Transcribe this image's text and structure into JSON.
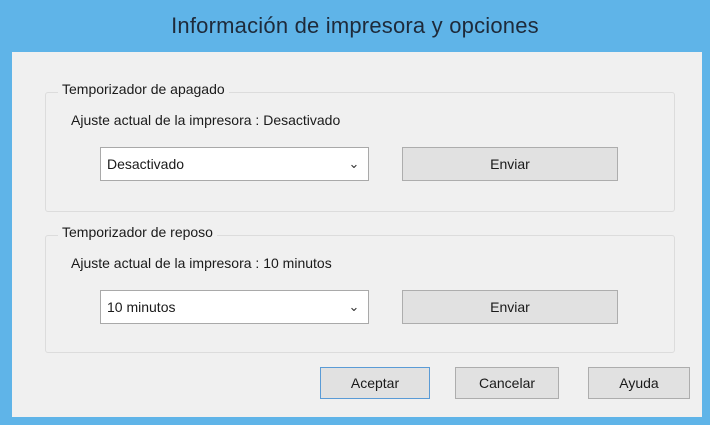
{
  "window": {
    "title": "Información de impresora y opciones"
  },
  "power_off_timer": {
    "legend": "Temporizador de apagado",
    "current_setting": "Ajuste actual de la impresora : Desactivado",
    "selected": "Desactivado",
    "send_label": "Enviar"
  },
  "sleep_timer": {
    "legend": "Temporizador de reposo",
    "current_setting": "Ajuste actual de la impresora : 10 minutos",
    "selected": "10 minutos",
    "send_label": "Enviar"
  },
  "footer": {
    "ok_label": "Aceptar",
    "cancel_label": "Cancelar",
    "help_label": "Ayuda"
  },
  "icons": {
    "dropdown": "chevron-down-icon"
  },
  "colors": {
    "titlebar": "#5fb4e8",
    "client": "#f0f0f0",
    "button": "#e1e1e1",
    "default_button_border": "#5a9bd6"
  }
}
